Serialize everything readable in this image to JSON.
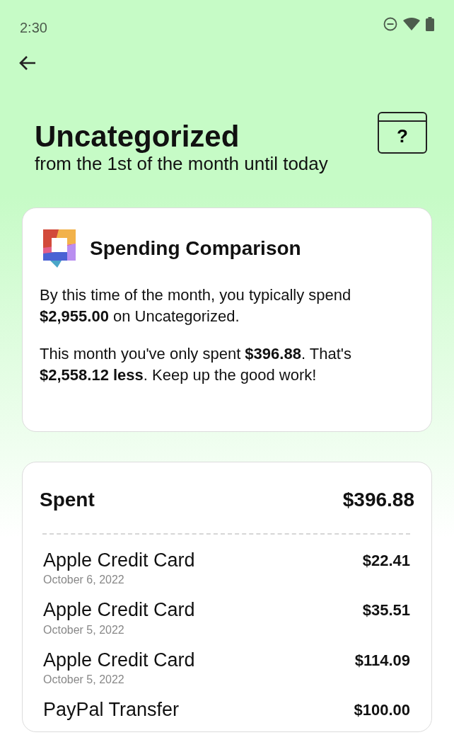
{
  "status_bar": {
    "time": "2:30"
  },
  "header": {
    "title": "Uncategorized",
    "subtitle": "from the 1st of the month until today",
    "help_label": "?"
  },
  "comparison_card": {
    "title": "Spending Comparison",
    "paragraphs": [
      "By this time of the month, you typically spend **$2,955.00** on Uncategorized.",
      "This month you've only spent **$396.88**. That's **$2,558.12 less**. Keep up the good work!"
    ]
  },
  "spent_card": {
    "label": "Spent",
    "total": "$396.88",
    "transactions": [
      {
        "name": "Apple Credit Card",
        "date": "October 6, 2022",
        "amount": "$22.41"
      },
      {
        "name": "Apple Credit Card",
        "date": "October 5, 2022",
        "amount": "$35.51"
      },
      {
        "name": "Apple Credit Card",
        "date": "October 5, 2022",
        "amount": "$114.09"
      },
      {
        "name": "PayPal Transfer",
        "amount": "$100.00"
      }
    ]
  }
}
